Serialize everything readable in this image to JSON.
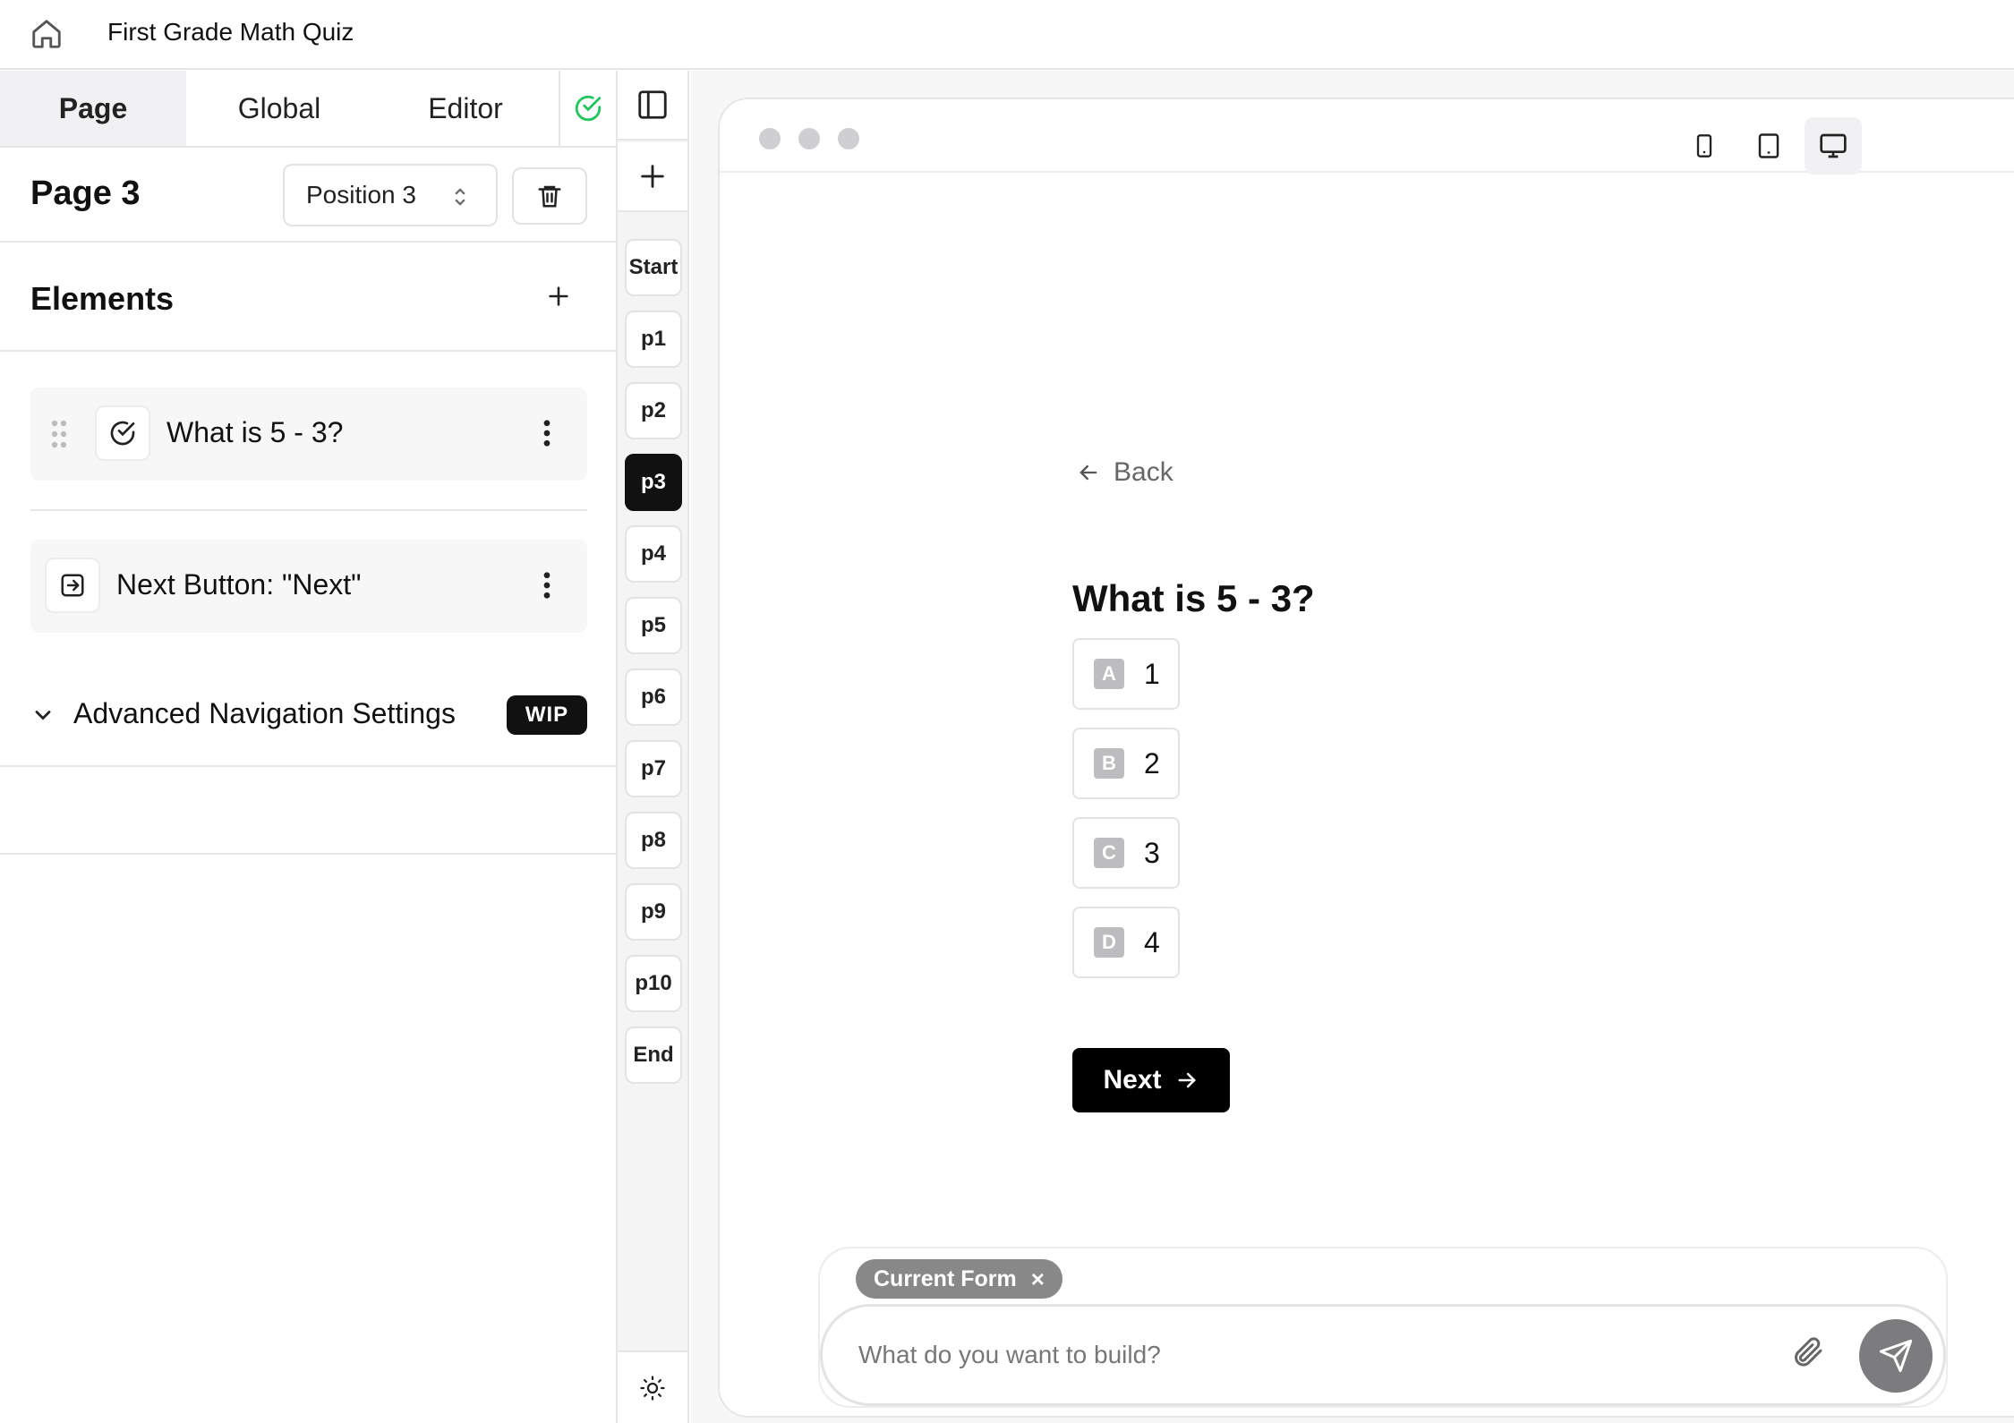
{
  "header": {
    "title": "First Grade Math Quiz",
    "home_icon": "home-icon"
  },
  "left_panel": {
    "tabs": [
      {
        "label": "Page",
        "active": true
      },
      {
        "label": "Global",
        "active": false
      },
      {
        "label": "Editor",
        "active": false
      }
    ],
    "status_icon": "check-circle-icon",
    "status_color": "#22c55e",
    "page_title": "Page 3",
    "position_select": "Position 3",
    "elements_title": "Elements",
    "elements": [
      {
        "label": "What is 5 - 3?",
        "icon": "check-circle-icon"
      },
      {
        "label": "Next Button: \"Next\"",
        "icon": "arrow-right-box-icon"
      }
    ],
    "advanced": {
      "label": "Advanced Navigation Settings",
      "badge": "WIP"
    }
  },
  "page_strip": {
    "pages": [
      "Start",
      "p1",
      "p2",
      "p3",
      "p4",
      "p5",
      "p6",
      "p7",
      "p8",
      "p9",
      "p10",
      "End"
    ],
    "active": "p3"
  },
  "preview": {
    "back_label": "Back",
    "question": "What is 5 - 3?",
    "options": [
      {
        "key": "A",
        "value": "1"
      },
      {
        "key": "B",
        "value": "2"
      },
      {
        "key": "C",
        "value": "3"
      },
      {
        "key": "D",
        "value": "4"
      }
    ],
    "next_label": "Next",
    "active_device": "desktop"
  },
  "chat": {
    "chip_label": "Current Form",
    "placeholder": "What do you want to build?"
  }
}
